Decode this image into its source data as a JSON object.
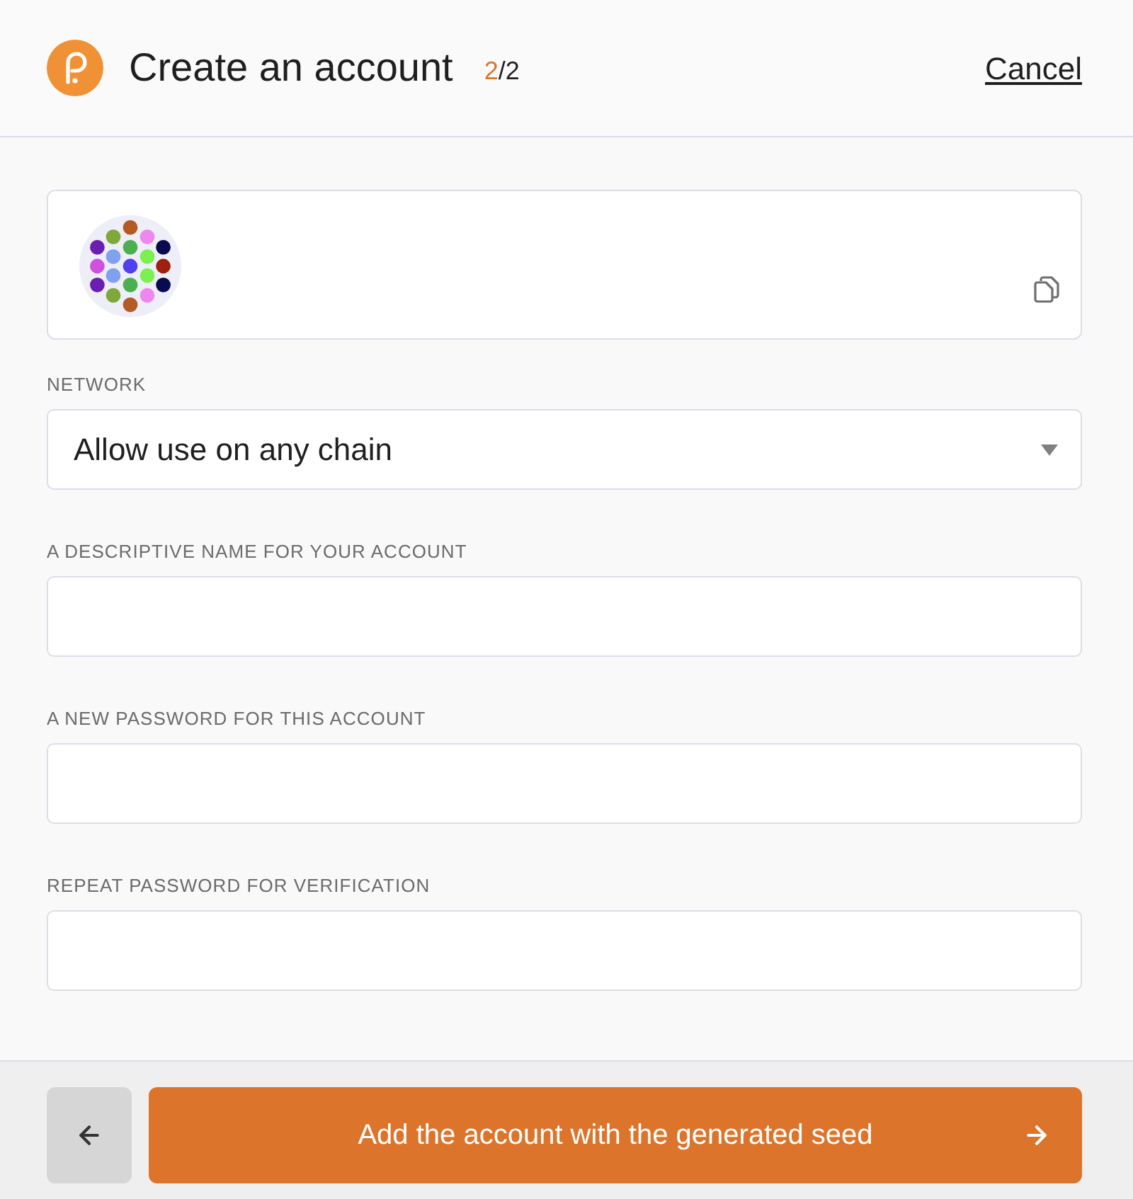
{
  "header": {
    "title": "Create an account",
    "step": {
      "current": "2",
      "of_total": "/2"
    },
    "cancel": "Cancel"
  },
  "fields": [
    {
      "kind": "select",
      "label": "NETWORK",
      "value": "Allow use on any chain"
    },
    {
      "kind": "text",
      "label": "A DESCRIPTIVE NAME FOR YOUR ACCOUNT"
    },
    {
      "kind": "password",
      "label": "A NEW PASSWORD FOR THIS ACCOUNT"
    },
    {
      "kind": "password",
      "label": "REPEAT PASSWORD FOR VERIFICATION"
    }
  ],
  "footer": {
    "submit_button": "Add the account with the generated seed"
  }
}
